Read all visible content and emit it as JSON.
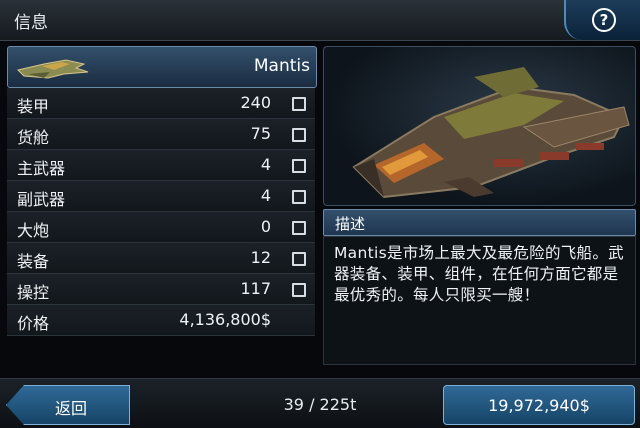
{
  "header": {
    "title": "信息",
    "help_icon": "?"
  },
  "ship": {
    "name": "Mantis",
    "stats": [
      {
        "label": "装甲",
        "value": "240"
      },
      {
        "label": "货舱",
        "value": "75"
      },
      {
        "label": "主武器",
        "value": "4"
      },
      {
        "label": "副武器",
        "value": "4"
      },
      {
        "label": "大炮",
        "value": "0"
      },
      {
        "label": "装备",
        "value": "12"
      },
      {
        "label": "操控",
        "value": "117"
      }
    ],
    "price_label": "价格",
    "price_value": "4,136,800$"
  },
  "description": {
    "title": "描述",
    "text": "Mantis是市场上最大及最危险的飞船。武器装备、装甲、组件，在任何方面它都是最优秀的。每人只限买一艘！"
  },
  "footer": {
    "back_label": "返回",
    "cargo": "39 / 225t",
    "money": "19,972,940$"
  },
  "colors": {
    "accent": "#2f6a97",
    "panel": "#1b2127"
  }
}
